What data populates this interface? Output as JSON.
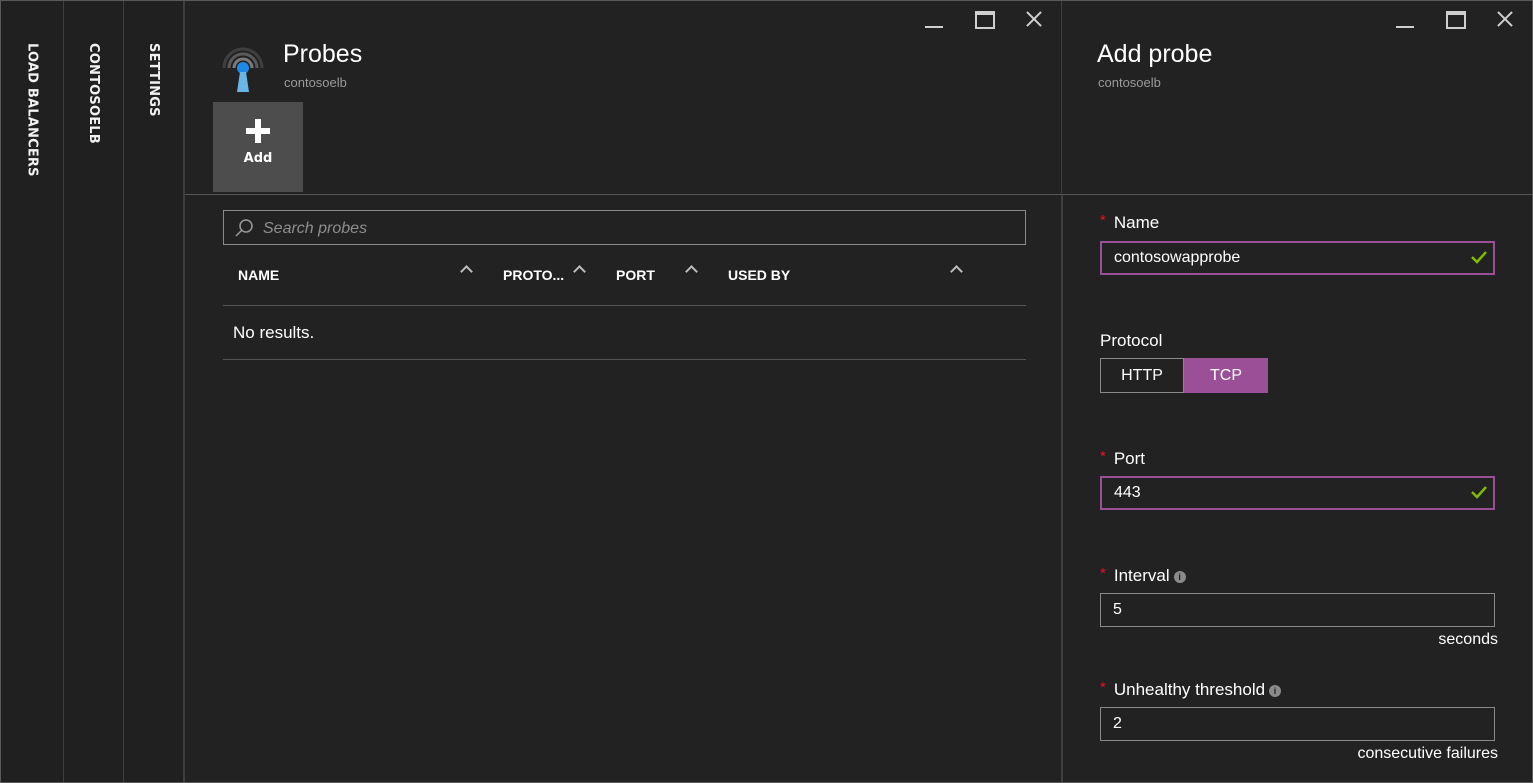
{
  "rails": {
    "load_balancers": "LOAD BALANCERS",
    "contosoelb": "CONTOSOELB",
    "settings": "SETTINGS"
  },
  "probes_blade": {
    "title": "Probes",
    "subtitle": "contosoelb",
    "add_label": "Add",
    "search_placeholder": "Search probes",
    "columns": [
      "NAME",
      "PROTO...",
      "PORT",
      "USED BY"
    ],
    "empty_text": "No results."
  },
  "add_probe_blade": {
    "title": "Add probe",
    "subtitle": "contosoelb",
    "name_label": "Name",
    "name_value": "contosowapprobe",
    "protocol_label": "Protocol",
    "protocol_options": [
      "HTTP",
      "TCP"
    ],
    "protocol_selected": "TCP",
    "port_label": "Port",
    "port_value": "443",
    "interval_label": "Interval",
    "interval_value": "5",
    "interval_unit": "seconds",
    "threshold_label": "Unhealthy threshold",
    "threshold_value": "2",
    "threshold_unit": "consecutive failures",
    "required_marker": "*",
    "info_glyph": "i"
  },
  "colors": {
    "accent": "#9b4f96",
    "valid_check": "#7fba00",
    "required": "#e81123",
    "background": "#222222"
  },
  "icons": {
    "probe": "probe-antenna-icon",
    "add": "plus-icon",
    "search": "search-icon",
    "valid": "check-icon",
    "info": "info-icon"
  }
}
